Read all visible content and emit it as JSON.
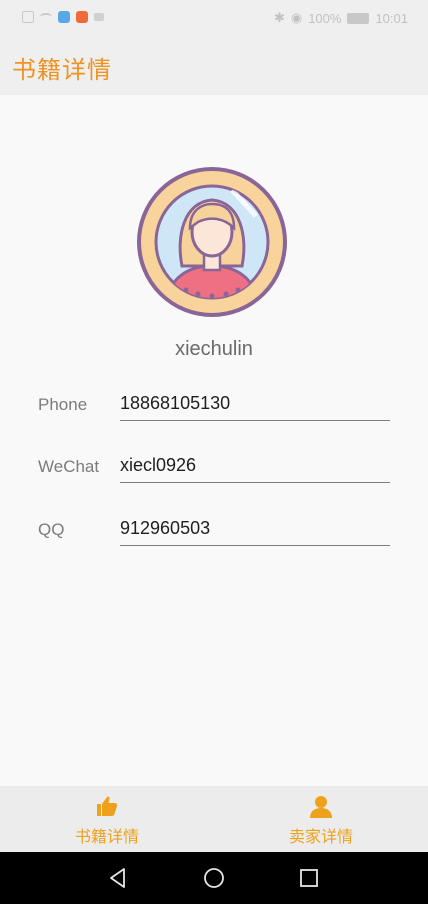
{
  "status_bar": {
    "battery_text": "100%",
    "time": "10:01"
  },
  "app_bar": {
    "title": "书籍详情"
  },
  "profile": {
    "username": "xiechulin",
    "fields": [
      {
        "label": "Phone",
        "value": "18868105130"
      },
      {
        "label": "WeChat",
        "value": "xiecl0926"
      },
      {
        "label": "QQ",
        "value": "912960503"
      }
    ]
  },
  "bottom_nav": {
    "items": [
      {
        "label": "书籍详情",
        "icon": "thumbs-up-icon"
      },
      {
        "label": "卖家详情",
        "icon": "person-icon"
      }
    ]
  },
  "colors": {
    "accent": "#ee9320",
    "nav_active": "#eea21b"
  }
}
